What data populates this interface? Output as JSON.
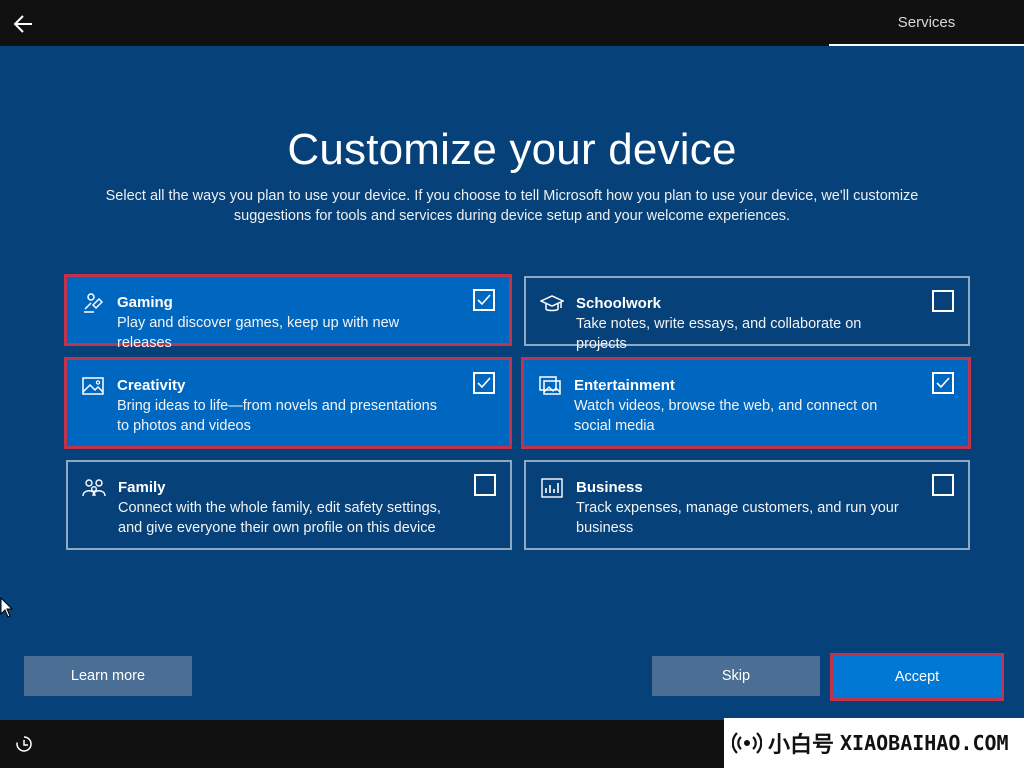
{
  "header": {
    "tab_label": "Services"
  },
  "main": {
    "title": "Customize your device",
    "subtitle": "Select all the ways you plan to use your device. If you choose to tell Microsoft how you plan to use your device, we'll customize suggestions for tools and services during device setup and your welcome experiences."
  },
  "options": [
    {
      "name": "Gaming",
      "desc": "Play and discover games, keep up with new releases",
      "checked": true,
      "icon": "gaming-icon"
    },
    {
      "name": "Schoolwork",
      "desc": "Take notes, write essays, and collaborate on projects",
      "checked": false,
      "icon": "graduation-cap-icon"
    },
    {
      "name": "Creativity",
      "desc": "Bring ideas to life—from novels and presentations to photos and videos",
      "checked": true,
      "icon": "picture-icon"
    },
    {
      "name": "Entertainment",
      "desc": "Watch videos, browse the web, and connect on social media",
      "checked": true,
      "icon": "photos-icon"
    },
    {
      "name": "Family",
      "desc": "Connect with the whole family, edit safety settings, and give everyone their own profile on this device",
      "checked": false,
      "icon": "family-icon"
    },
    {
      "name": "Business",
      "desc": "Track expenses, manage customers, and run your business",
      "checked": false,
      "icon": "business-icon"
    }
  ],
  "buttons": {
    "learn_more": "Learn more",
    "skip": "Skip",
    "accept": "Accept"
  },
  "watermark": {
    "chinese": "小白号",
    "domain": "XIAOBAIHAO.COM"
  },
  "colors": {
    "background": "#06417a",
    "selected": "#0067c0",
    "highlight": "#c0334d",
    "accent": "#0078d4"
  }
}
